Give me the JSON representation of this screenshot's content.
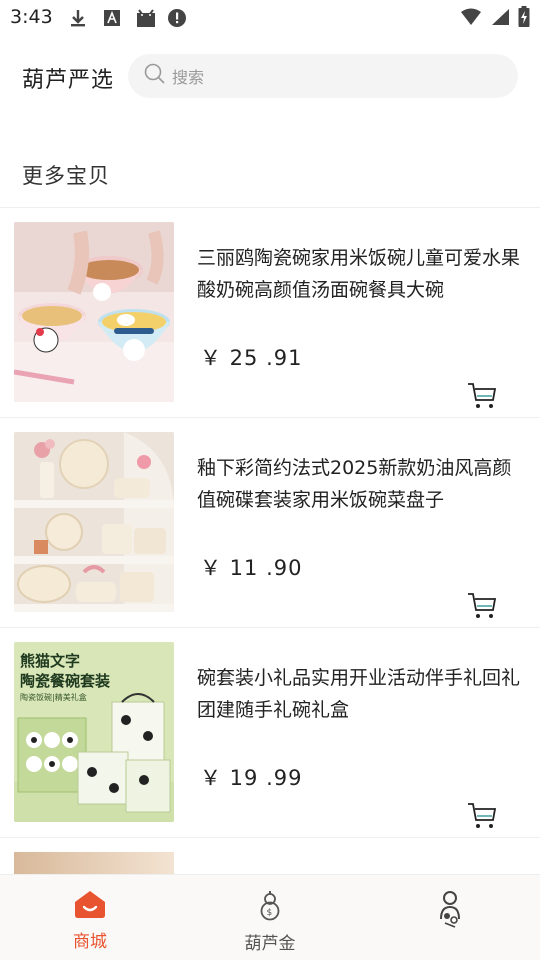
{
  "status_bar": {
    "time": "3:43"
  },
  "header": {
    "title": "葫芦严选",
    "search_placeholder": "搜索"
  },
  "section": {
    "title": "更多宝贝"
  },
  "products": [
    {
      "title": "三丽鸥陶瓷碗家用米饭碗儿童可爱水果酸奶碗高颜值汤面碗餐具大碗",
      "price": "￥ 25 .91"
    },
    {
      "title": "釉下彩简约法式2025新款奶油风高颜值碗碟套装家用米饭碗菜盘子",
      "price": "￥ 11 .90"
    },
    {
      "title": "碗套装小礼品实用开业活动伴手礼回礼团建随手礼碗礼盒",
      "price": "￥ 19 .99"
    }
  ],
  "product3_image_text": {
    "line1": "熊猫文字",
    "line2": "陶瓷餐碗套装",
    "line3": "陶瓷饭碗|精美礼盒"
  },
  "bottom_nav": [
    {
      "label": "商城",
      "active": true
    },
    {
      "label": "葫芦金",
      "active": false
    },
    {
      "label": "",
      "active": false
    }
  ],
  "colors": {
    "accent": "#e8542f",
    "inactive": "#555555",
    "cart": "#222222"
  }
}
